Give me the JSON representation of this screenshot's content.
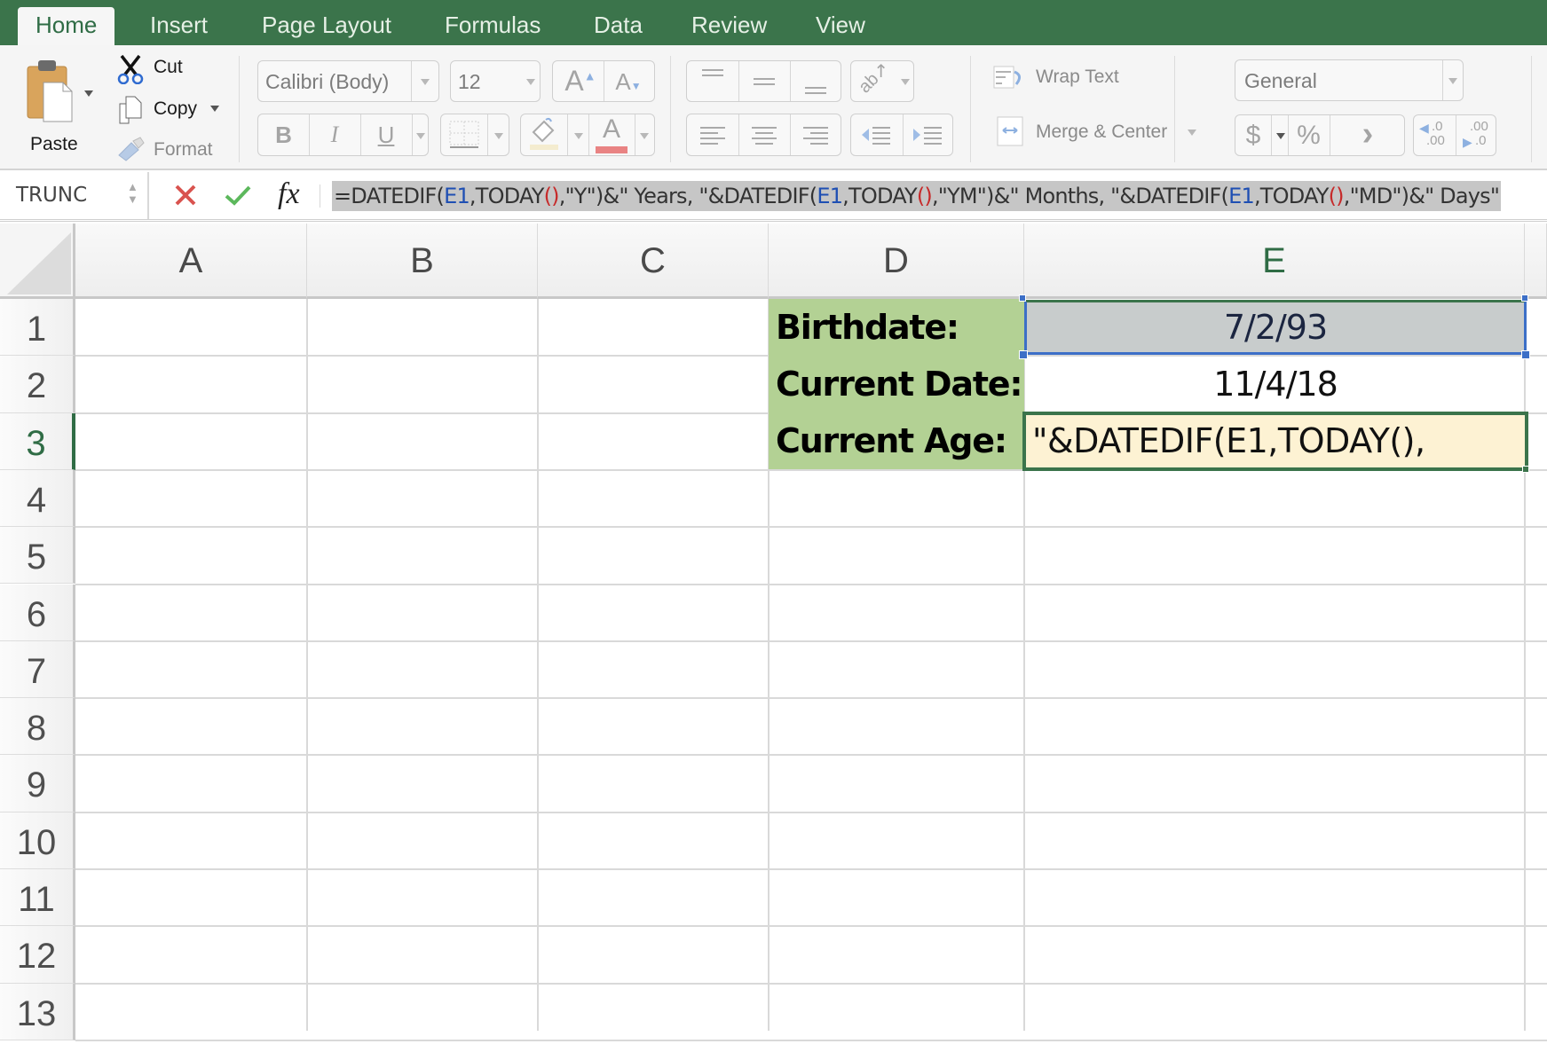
{
  "tabs": [
    {
      "label": "Home",
      "active": true
    },
    {
      "label": "Insert"
    },
    {
      "label": "Page Layout"
    },
    {
      "label": "Formulas"
    },
    {
      "label": "Data"
    },
    {
      "label": "Review"
    },
    {
      "label": "View"
    }
  ],
  "ribbon": {
    "clipboard": {
      "paste": "Paste",
      "cut": "Cut",
      "copy": "Copy",
      "format": "Format"
    },
    "font": {
      "name": "Calibri (Body)",
      "size": "12",
      "bold": "B",
      "italic": "I",
      "underline": "U",
      "grow": "A",
      "shrink": "A",
      "color_glyph": "A"
    },
    "alignment": {
      "wrap_text": "Wrap Text",
      "merge_center": "Merge & Center"
    },
    "number": {
      "format": "General",
      "currency": "$",
      "percent": "%",
      "comma": "›",
      "inc_decimal_top": ".0",
      "inc_decimal_bottom": ".00",
      "dec_decimal_top": ".00",
      "dec_decimal_bottom": ".0"
    }
  },
  "formula_bar": {
    "name_box": "TRUNC",
    "fx_label": "fx",
    "parts": [
      {
        "t": "=DATEDIF(",
        "c": "text"
      },
      {
        "t": "E1",
        "c": "ref"
      },
      {
        "t": ",TODAY",
        "c": "text"
      },
      {
        "t": "()",
        "c": "paren"
      },
      {
        "t": ",\"Y\")&\" Years, \"&DATEDIF(",
        "c": "text"
      },
      {
        "t": "E1",
        "c": "ref"
      },
      {
        "t": ",TODAY",
        "c": "text"
      },
      {
        "t": "()",
        "c": "paren"
      },
      {
        "t": ",\"YM\")&\" Months, \"&DATEDIF(",
        "c": "text"
      },
      {
        "t": "E1",
        "c": "ref"
      },
      {
        "t": ",TODAY",
        "c": "text"
      },
      {
        "t": "()",
        "c": "paren"
      },
      {
        "t": ",\"MD\")&\" Days\"",
        "c": "text"
      }
    ]
  },
  "sheet": {
    "columns": [
      "A",
      "B",
      "C",
      "D",
      "E"
    ],
    "selected_column": "E",
    "rows": [
      "1",
      "2",
      "3",
      "4",
      "5",
      "6",
      "7",
      "8",
      "9",
      "10",
      "11",
      "12",
      "13"
    ],
    "selected_row": "3",
    "cells": {
      "D1": "Birthdate:",
      "D2": "Current Date:",
      "D3": "Current Age:",
      "E1": "7/2/93",
      "E2": "11/4/18",
      "E3": "\"&DATEDIF(E1,TODAY(),"
    }
  },
  "colors": {
    "ribbon_green": "#3b744b",
    "label_fill": "#b3d194",
    "edit_cell_fill": "#fdf2d3",
    "ref_blue": "#1f4fb3",
    "paren_red": "#c62a2a"
  }
}
